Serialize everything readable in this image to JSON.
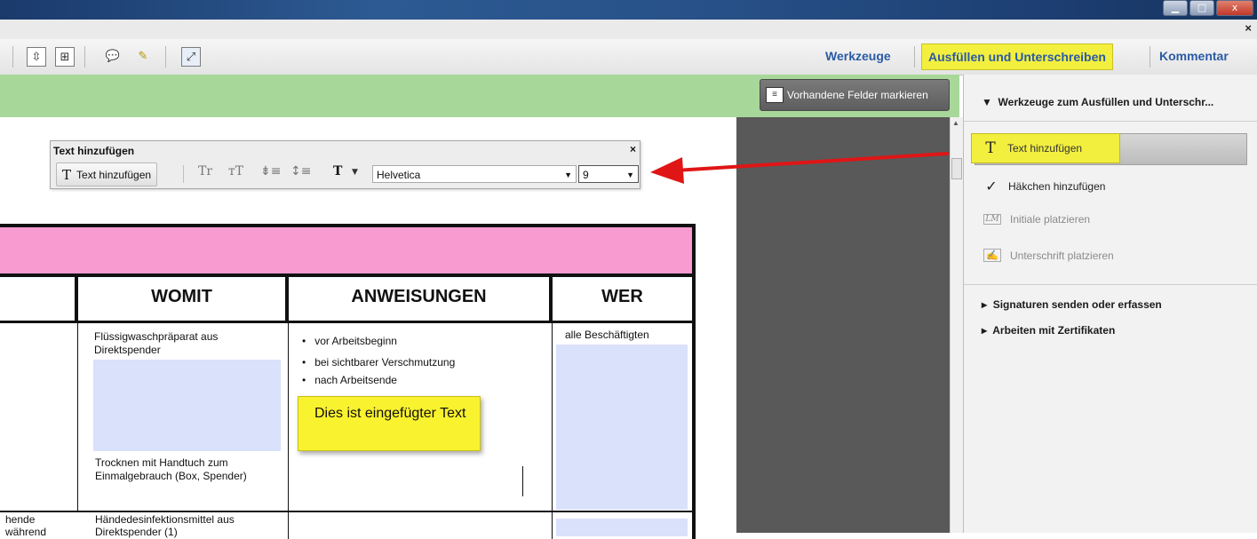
{
  "window": {
    "controls": [
      "▁",
      "□",
      "x"
    ],
    "doc_close": "×"
  },
  "toolbar": {
    "werkzeuge": "Werkzeuge",
    "ausfuellen": "Ausfüllen und Unterschreiben",
    "kommentar": "Kommentar"
  },
  "greenbar": {
    "mark_fields_label": "Vorhandene Felder markieren"
  },
  "text_panel": {
    "title": "Text hinzufügen",
    "close": "×",
    "add_text_label": "Text hinzufügen",
    "font": "Helvetica",
    "size": "9"
  },
  "form": {
    "headers": {
      "womit": "WOMIT",
      "anweisungen": "ANWEISUNGEN",
      "wer": "WER"
    },
    "row1": {
      "womit_top": "Flüssigwaschpräparat aus Direktspender",
      "womit_bottom": "Trocknen mit Handtuch zum Einmalgebrauch (Box, Spender)",
      "bullets": [
        "vor Arbeitsbeginn",
        "bei sichtbarer Verschmutzung",
        "nach Arbeitsende"
      ],
      "wer": "alle Beschäftigten"
    },
    "row2": {
      "left_line1": "hende",
      "left_line2": "während",
      "womit_line1": "Händedesinfektionsmittel aus",
      "womit_line2": "Direktspender (1)"
    },
    "inserted_text": "Dies ist eingefügter Text"
  },
  "right_panel": {
    "section_title": "Werkzeuge zum Ausfüllen und Unterschr...",
    "items": [
      {
        "label": "Text hinzufügen",
        "icon": "T"
      },
      {
        "label": "Häkchen hinzufügen",
        "icon": "✓"
      },
      {
        "label": "Initiale platzieren",
        "icon": "LM"
      },
      {
        "label": "Unterschrift platzieren",
        "icon": "✍"
      }
    ],
    "collapsed_sections": [
      "Signaturen senden oder erfassen",
      "Arbeiten mit Zertifikaten"
    ]
  },
  "colors": {
    "highlight_yellow": "#f2ef3e",
    "green_bar": "#a8d79a",
    "pink_header": "#f79bd0",
    "arrow_red": "#e01515",
    "field_blue": "#d9e1fb"
  }
}
